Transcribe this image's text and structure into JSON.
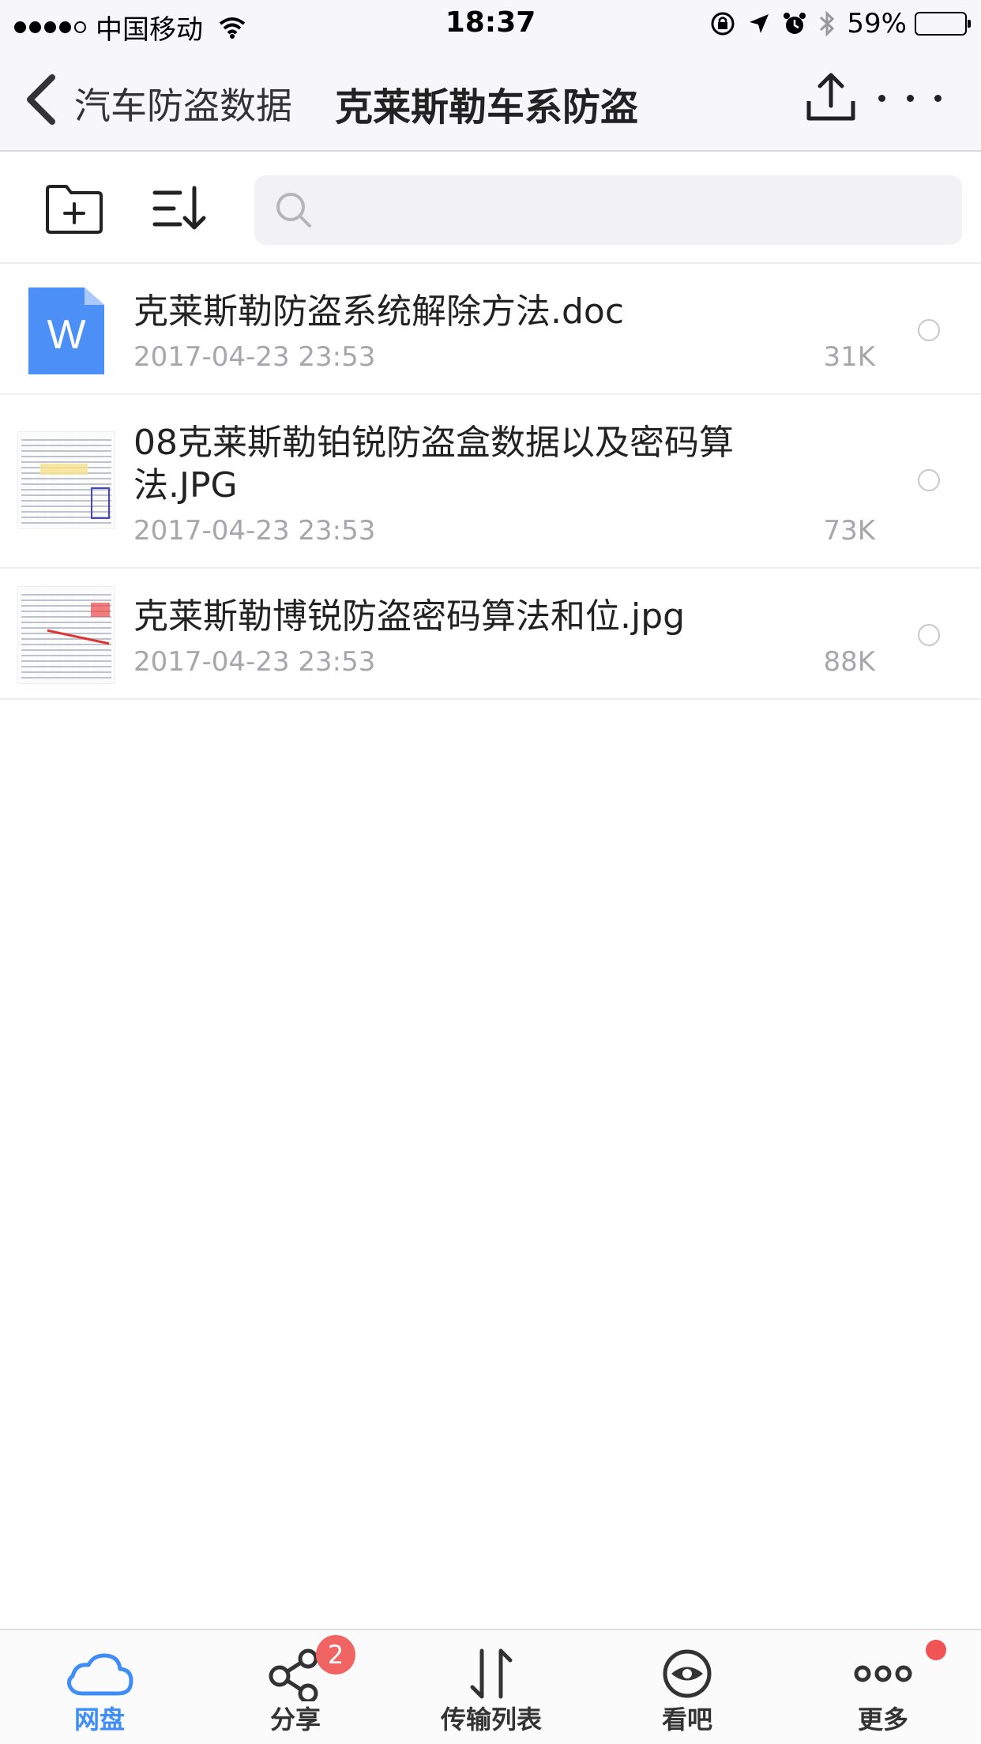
{
  "status_bar": {
    "carrier": "中国移动",
    "time": "18:37",
    "battery": "59%",
    "battery_level": 0.59
  },
  "nav": {
    "back_icon": "chevron-left-icon",
    "parent_title": "汽车防盗数据",
    "title": "克莱斯勒车系防盗",
    "upload_icon": "upload-icon",
    "more_icon": "more-icon"
  },
  "toolbar": {
    "new_folder_icon": "new-folder-icon",
    "sort_icon": "sort-icon",
    "search_placeholder": "",
    "search_icon": "search-icon"
  },
  "files": [
    {
      "name": "克莱斯勒防盗系统解除方法.doc",
      "date": "2017-04-23 23:53",
      "size": "31K",
      "type": "doc",
      "icon_letter": "W"
    },
    {
      "name": "08克莱斯勒铂锐防盗盒数据以及密码算法.JPG",
      "date": "2017-04-23 23:53",
      "size": "73K",
      "type": "image"
    },
    {
      "name": "克莱斯勒博锐防盗密码算法和位.jpg",
      "date": "2017-04-23 23:53",
      "size": "88K",
      "type": "image"
    }
  ],
  "tabs": [
    {
      "label": "网盘",
      "icon": "cloud-icon",
      "active": true
    },
    {
      "label": "分享",
      "icon": "share-icon",
      "badge": "2"
    },
    {
      "label": "传输列表",
      "icon": "transfer-icon"
    },
    {
      "label": "看吧",
      "icon": "eye-icon"
    },
    {
      "label": "更多",
      "icon": "more-dots-icon",
      "dot": true
    }
  ],
  "colors": {
    "accent": "#3f8ef7",
    "badge": "#f06464",
    "doc_icon": "#4b8ff7"
  }
}
